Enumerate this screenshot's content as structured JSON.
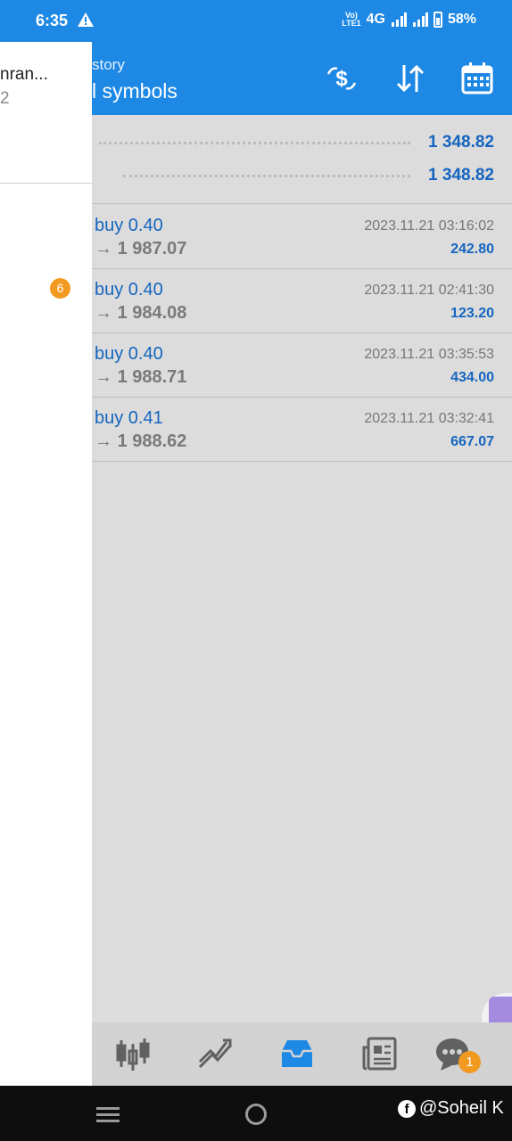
{
  "status_bar": {
    "time": "6:35",
    "network_top": "Vo)",
    "network_bottom": "LTE1",
    "network_type": "4G",
    "battery": "58%"
  },
  "header": {
    "subtitle": "story",
    "title": "l symbols"
  },
  "summary": {
    "rows": [
      {
        "value": "1 348.82"
      },
      {
        "value": "1 348.82"
      }
    ]
  },
  "deals": [
    {
      "type": "buy 0.40",
      "price": "1 987.07",
      "time": "2023.11.21 03:16:02",
      "profit": "242.80"
    },
    {
      "type": "buy 0.40",
      "price": "1 984.08",
      "time": "2023.11.21 02:41:30",
      "profit": "123.20"
    },
    {
      "type": "buy 0.40",
      "price": "1 988.71",
      "time": "2023.11.21 03:35:53",
      "profit": "434.00"
    },
    {
      "type": "buy 0.41",
      "price": "1 988.62",
      "time": "2023.11.21 03:32:41",
      "profit": "667.07"
    }
  ],
  "price_arrow": "→",
  "drawer": {
    "account_name": "nran...",
    "account_number": "2",
    "badge": "6"
  },
  "bottom_nav": {
    "items": [
      "quotes-icon",
      "chart-icon",
      "trade-icon",
      "news-icon",
      "chat-icon"
    ],
    "chat_badge": "1"
  },
  "watermark": {
    "fb": "f",
    "text": "@Soheil K"
  },
  "colors": {
    "primary": "#1e88e5",
    "value_blue": "#1565c0",
    "badge_orange": "#f29a1f"
  }
}
